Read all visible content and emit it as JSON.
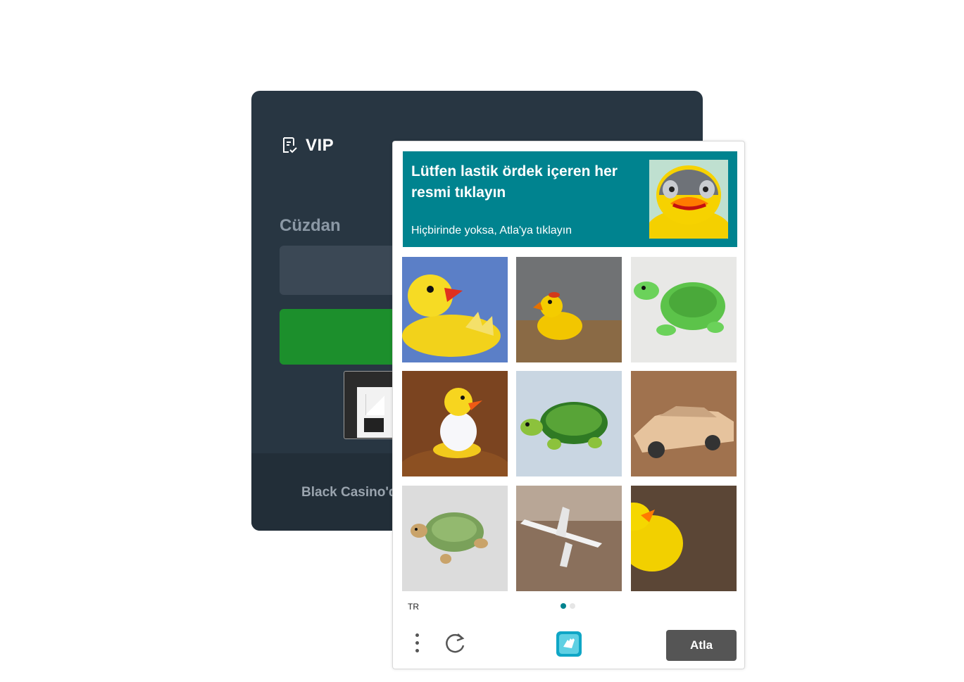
{
  "background_card": {
    "vip_label": "VIP",
    "wallet_label": "Cüzdan",
    "footer_text": "Black Casino'd"
  },
  "captcha": {
    "prompt_title": "Lütfen lastik ördek içeren her resmi tıklayın",
    "prompt_subtitle": "Hiçbirinde yoksa, Atla'ya tıklayın",
    "example_image": "rubber-duck",
    "tiles": [
      "rubber-duck-blue-background",
      "rubber-duck-on-table",
      "green-toy-turtle",
      "duckling-in-eggshell",
      "toy-turtle",
      "toy-car",
      "toy-turtle-small",
      "toy-airplane",
      "rubber-duck-closeup"
    ],
    "language": "TR",
    "page_indicator": {
      "current": 1,
      "total": 2
    },
    "skip_label": "Atla",
    "accent_color": "#00838f",
    "skip_color": "#555555",
    "icons": [
      "more-vertical-icon",
      "refresh-icon",
      "hcaptcha-logo-icon"
    ]
  }
}
